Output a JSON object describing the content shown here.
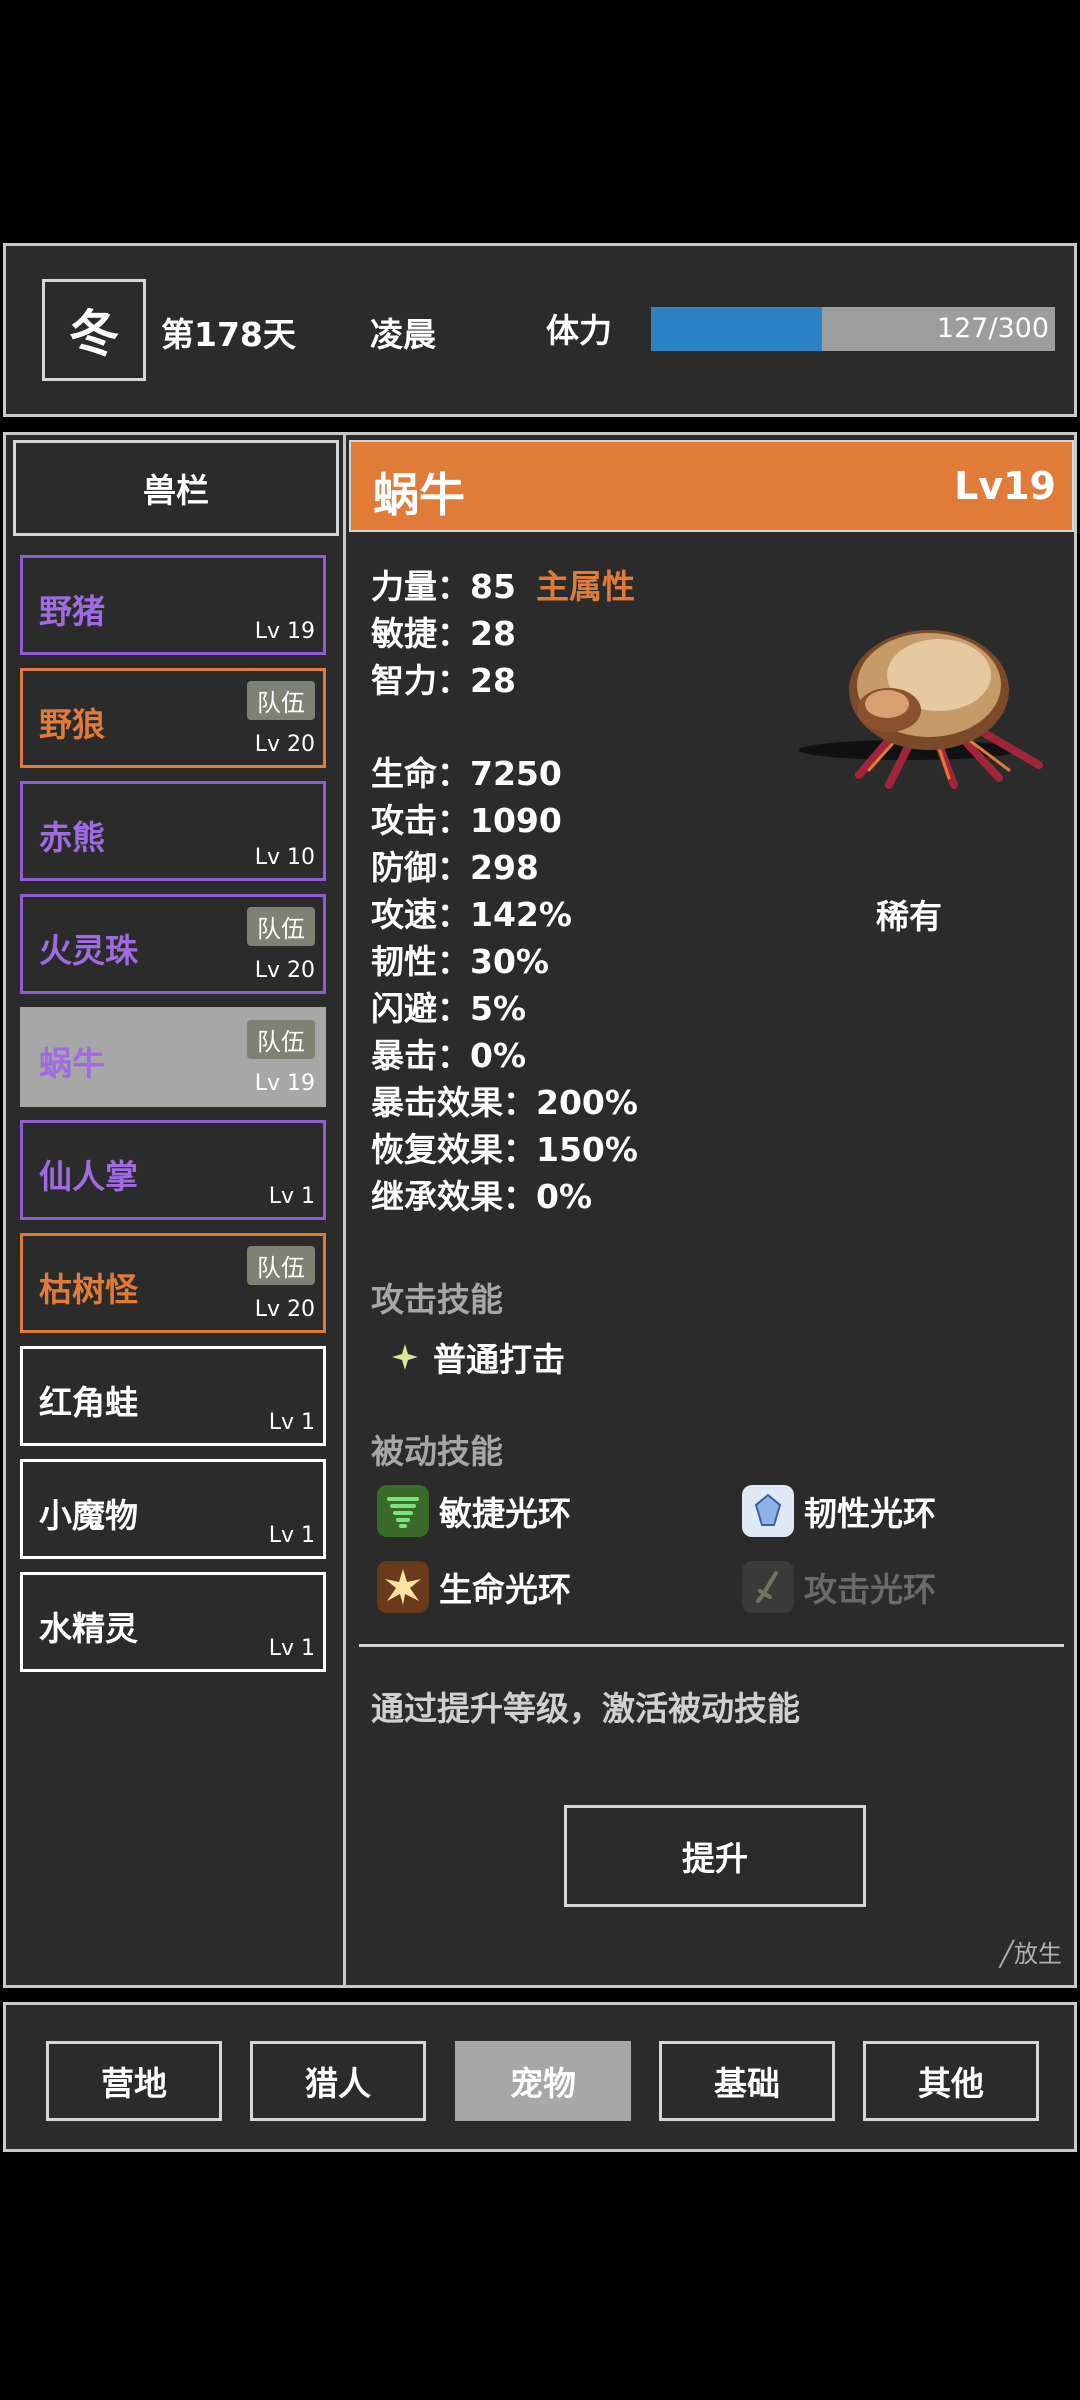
{
  "header": {
    "season": "冬",
    "day": "第178天",
    "time": "凌晨",
    "stamina_label": "体力",
    "stamina_text": "127/300",
    "stamina_fraction": 0.423
  },
  "tab_title": "兽栏",
  "pets": [
    {
      "name": "野猪",
      "level": "Lv 19",
      "badge": "",
      "color": "purple",
      "selected": false
    },
    {
      "name": "野狼",
      "level": "Lv 20",
      "badge": "队伍",
      "color": "orange",
      "selected": false
    },
    {
      "name": "赤熊",
      "level": "Lv 10",
      "badge": "",
      "color": "purple",
      "selected": false
    },
    {
      "name": "火灵珠",
      "level": "Lv 20",
      "badge": "队伍",
      "color": "purple",
      "selected": false
    },
    {
      "name": "蜗牛",
      "level": "Lv 19",
      "badge": "队伍",
      "color": "purple",
      "selected": true
    },
    {
      "name": "仙人掌",
      "level": "Lv 1",
      "badge": "",
      "color": "purple",
      "selected": false
    },
    {
      "name": "枯树怪",
      "level": "Lv 20",
      "badge": "队伍",
      "color": "orange",
      "selected": false
    },
    {
      "name": "红角蛙",
      "level": "Lv 1",
      "badge": "",
      "color": "white",
      "selected": false
    },
    {
      "name": "小魔物",
      "level": "Lv 1",
      "badge": "",
      "color": "white",
      "selected": false
    },
    {
      "name": "水精灵",
      "level": "Lv 1",
      "badge": "",
      "color": "white",
      "selected": false
    }
  ],
  "detail": {
    "name": "蜗牛",
    "level": "Lv19",
    "main_attr_label": "主属性",
    "rarity": "稀有",
    "stats": {
      "str": "力量：85",
      "agi": "敏捷：28",
      "int": "智力：28",
      "hp": "生命：7250",
      "atk": "攻击：1090",
      "def": "防御：298",
      "aspd": "攻速：142%",
      "tough": "韧性：30%",
      "dodge": "闪避：5%",
      "crit": "暴击：0%",
      "crit_eff": "暴击效果：200%",
      "recover_eff": "恢复效果：150%",
      "inherit_eff": "继承效果：0%"
    },
    "attack_skill_title": "攻击技能",
    "attack_skill": "普通打击",
    "passive_skill_title": "被动技能",
    "passive_skills": [
      "敏捷光环",
      "韧性光环",
      "生命光环",
      "攻击光环"
    ],
    "hint": "通过提升等级，激活被动技能",
    "upgrade_label": "提升",
    "release_label": "╱放生"
  },
  "nav": [
    "营地",
    "猎人",
    "宠物",
    "基础",
    "其他"
  ],
  "colors": {
    "accent_orange": "#e07b3a",
    "purple": "#a06be0",
    "stamina_blue": "#2e82c6",
    "active_gray": "#a7a7a7"
  }
}
